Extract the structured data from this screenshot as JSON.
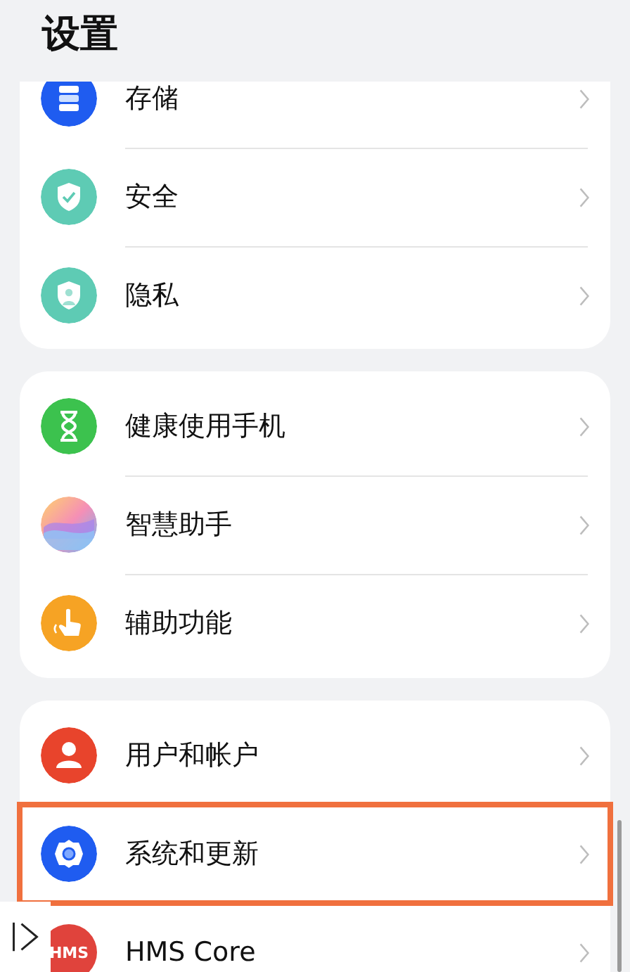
{
  "title": "设置",
  "groups": [
    {
      "items": [
        {
          "kind": "storage",
          "label": "存储",
          "highlighted": false
        },
        {
          "kind": "security",
          "label": "安全",
          "highlighted": false
        },
        {
          "kind": "privacy",
          "label": "隐私",
          "highlighted": false
        }
      ]
    },
    {
      "items": [
        {
          "kind": "digital-balance",
          "label": "健康使用手机",
          "highlighted": false
        },
        {
          "kind": "assistant",
          "label": "智慧助手",
          "highlighted": false
        },
        {
          "kind": "accessibility",
          "label": "辅助功能",
          "highlighted": false
        }
      ]
    },
    {
      "items": [
        {
          "kind": "users",
          "label": "用户和帐户",
          "highlighted": false
        },
        {
          "kind": "system",
          "label": "系统和更新",
          "highlighted": true
        },
        {
          "kind": "hms",
          "label": "HMS Core",
          "badge": "HMS",
          "highlighted": false
        }
      ]
    }
  ]
}
